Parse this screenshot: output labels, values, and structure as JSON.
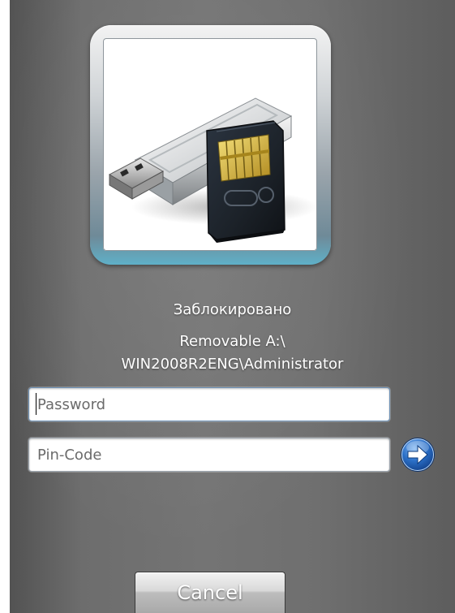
{
  "tile": {
    "icon": "usb-flash-drive-and-sd-card-icon"
  },
  "status": {
    "locked_label": "Заблокировано",
    "user_line1": "Removable A:\\",
    "user_line2": "WIN2008R2ENG\\Administrator"
  },
  "password": {
    "placeholder": "Password",
    "value": ""
  },
  "pin": {
    "placeholder": "Pin-Code",
    "value": ""
  },
  "submit": {
    "icon": "arrow-right-icon"
  },
  "cancel": {
    "label": "Cancel"
  },
  "colors": {
    "background": "#707070",
    "submit_blue": "#1d5fb8",
    "frame_accent": "#5fb0c8"
  }
}
